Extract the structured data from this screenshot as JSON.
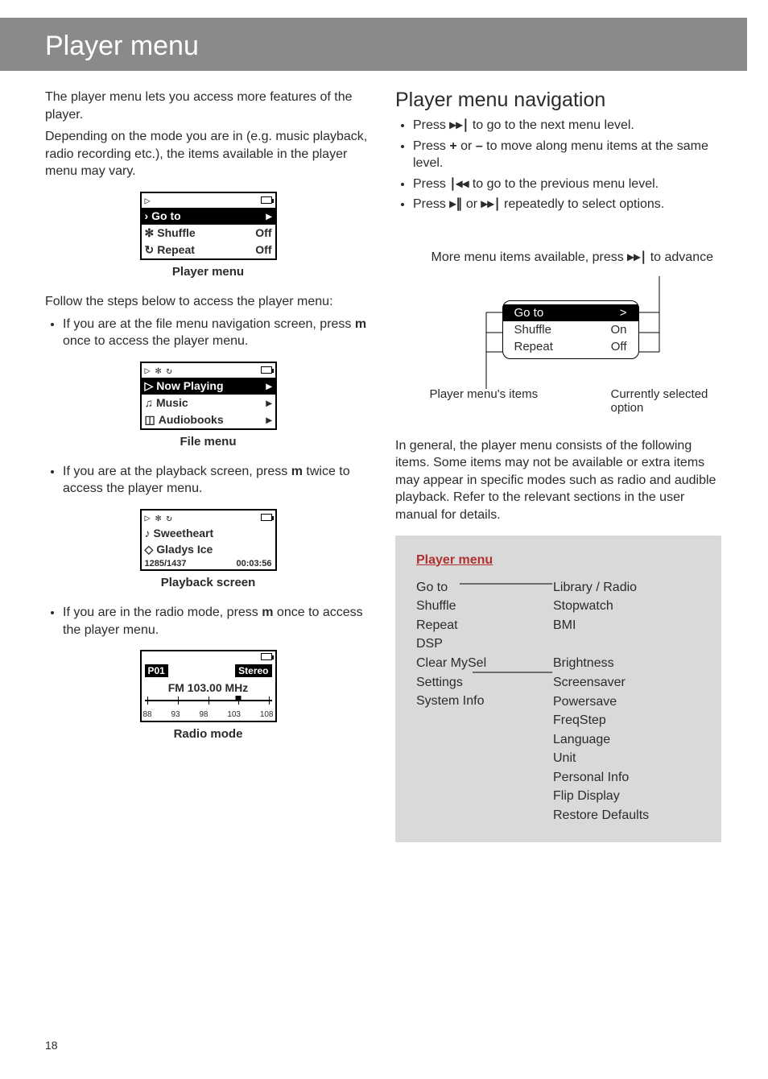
{
  "header": {
    "title": "Player menu"
  },
  "left": {
    "intro1": "The player menu lets you access more features of the player.",
    "intro2": "Depending on the mode you are in (e.g. music playback, radio recording etc.), the items available in the player menu may vary.",
    "fig1": {
      "caption": "Player menu",
      "rows": [
        {
          "icon": "›",
          "label": "Go to",
          "value": "",
          "selected": true,
          "right": "▸"
        },
        {
          "icon": "✻",
          "label": "Shuffle",
          "value": "Off",
          "selected": false
        },
        {
          "icon": "↻",
          "label": "Repeat",
          "value": "Off",
          "selected": false
        }
      ]
    },
    "follow": "Follow the steps below to access the player menu:",
    "b1_pre": "If you are at the file menu navigation screen, press ",
    "b1_key": "m",
    "b1_post": " once to access the player menu.",
    "fig2": {
      "caption": "File menu",
      "rows": [
        {
          "icon": "▷",
          "label": "Now Playing",
          "selected": true,
          "right": "▸"
        },
        {
          "icon": "♫",
          "label": "Music",
          "selected": false,
          "right": "▸"
        },
        {
          "icon": "◫",
          "label": "Audiobooks",
          "selected": false,
          "right": "▸"
        }
      ]
    },
    "b2_pre": "If you are at the playback screen, press ",
    "b2_key": "m",
    "b2_post": " twice to access the player menu.",
    "fig3": {
      "caption": "Playback screen",
      "title_icon": "♪",
      "title": "Sweetheart",
      "artist_icon": "◇",
      "artist": "Gladys Ice",
      "counter": "1285/1437",
      "time": "00:03:56"
    },
    "b3_pre": "If you are in the radio mode, press ",
    "b3_key": "m",
    "b3_post": " once to access the player menu.",
    "fig4": {
      "caption": "Radio mode",
      "preset": "P01",
      "stereo": "Stereo",
      "freq": "FM 103.00 MHz",
      "ticks": [
        "88",
        "93",
        "98",
        "103",
        "108"
      ]
    }
  },
  "right": {
    "h2": "Player menu navigation",
    "nav": {
      "i1a": "Press ",
      "i1b": " to go to the next menu level.",
      "g_fwd": "▸▸∣",
      "i2a": "Press ",
      "i2b": " or ",
      "i2c": " to move along menu items at the same level.",
      "g_plus": "+",
      "g_minus": "–",
      "i3a": "Press ",
      "i3b": " to go to the previous menu level.",
      "g_back": "∣◂◂",
      "i4a": "Press ",
      "i4b": " or ",
      "i4c": " repeatedly to select options.",
      "g_playpause": "▸∥"
    },
    "advance_a": "More menu items available, press ",
    "advance_b": " to advance",
    "g_fwd2": "▸▸∣",
    "wbox": {
      "rows": [
        {
          "label": "Go to",
          "value": ">",
          "selected": true
        },
        {
          "label": "Shuffle",
          "value": "On",
          "selected": false
        },
        {
          "label": "Repeat",
          "value": "Off",
          "selected": false
        }
      ]
    },
    "lbl_items": "Player menu's items",
    "lbl_selected": "Currently selected option",
    "para": "In general, the player menu consists of the following items. Some items may not be available or extra items may appear in specific modes such as radio and audible playback. Refer to the relevant sections in the user manual for details.",
    "menubox": {
      "title": "Player menu",
      "left": [
        "Go to",
        "Shuffle",
        "Repeat",
        "DSP",
        "Clear MySel",
        "Settings",
        "System Info"
      ],
      "right_top": [
        "Library / Radio",
        "Stopwatch",
        "BMI"
      ],
      "right_bottom": [
        "Brightness",
        "Screensaver",
        "Powersave",
        "FreqStep",
        "Language",
        "Unit",
        "Personal Info",
        "Flip Display",
        "Restore Defaults"
      ]
    }
  },
  "page_number": "18"
}
